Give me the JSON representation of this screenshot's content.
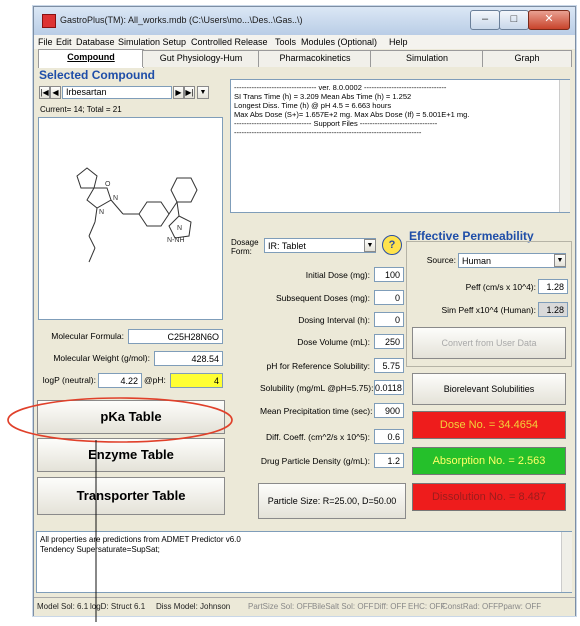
{
  "window": {
    "title": "GastroPlus(TM): All_works.mdb (C:\\Users\\mo...\\Des..\\Gas..\\)"
  },
  "menu": [
    "File",
    "Edit",
    "Database",
    "Simulation Setup",
    "Controlled Release",
    "Tools",
    "Modules (Optional)",
    "Help"
  ],
  "tabs": [
    "Compound",
    "Gut Physiology-Hum",
    "Pharmacokinetics",
    "Simulation",
    "Graph"
  ],
  "compound": {
    "section_title": "Selected Compound",
    "name": "Irbesartan",
    "current_total": "Current= 14; Total = 21",
    "molecular_formula_label": "Molecular Formula:",
    "molecular_formula": "C25H28N6O",
    "mw_label": "Molecular Weight (g/mol):",
    "mw": "428.54",
    "logp_label": "logP (neutral):",
    "logp": "4.22",
    "ph_label": "@pH:",
    "ph": "4"
  },
  "left_buttons": {
    "pka": "pKa Table",
    "enzyme": "Enzyme Table",
    "transporter": "Transporter Table"
  },
  "info_text": [
    "--------------------------------- ver. 8.0.0002 ---------------------------------",
    "SI Trans Time (h) = 3.209          Mean Abs Time (h) = 1.252",
    "Longest Diss. Time (h) @ pH 4.5 = 6.663 hours",
    "Max Abs Dose (S+)= 1.657E+2 mg.      Max Abs Dose (If) = 5.001E+1 mg.",
    "------------------------------- Support Files -------------------------------",
    "---------------------------------------------------------------------------"
  ],
  "dosage": {
    "form_label": "Dosage Form:",
    "form_value": "IR: Tablet",
    "rows": [
      {
        "label": "Initial Dose (mg):",
        "value": "100"
      },
      {
        "label": "Subsequent Doses (mg):",
        "value": "0"
      },
      {
        "label": "Dosing Interval (h):",
        "value": "0"
      },
      {
        "label": "Dose Volume (mL):",
        "value": "250"
      },
      {
        "label": "pH for Reference Solubility:",
        "value": "5.75"
      },
      {
        "label": "Solubility (mg/mL @pH=5.75):",
        "value": "0.0118"
      },
      {
        "label": "Mean Precipitation time (sec):",
        "value": "900"
      },
      {
        "label": "Diff. Coeff. (cm^2/s x 10^5):",
        "value": "0.6"
      },
      {
        "label": "Drug Particle Density (g/mL):",
        "value": "1.2"
      }
    ],
    "particle_size": "Particle Size: R=25.00, D=50.00"
  },
  "permeability": {
    "title": "Effective Permeability",
    "source_label": "Source:",
    "source_value": "Human",
    "peff_label": "Peff (cm/s x 10^4):",
    "peff": "1.28",
    "sim_label": "Sim Peff x10^4 (Human):",
    "sim": "1.28",
    "convert_btn": "Convert from User Data",
    "biorelevant_btn": "Biorelevant Solubilities"
  },
  "results": {
    "dose": "Dose No. = 34.4654",
    "absorption": "Absorption No. = 2.563",
    "dissolution": "Dissolution No. = 8.487"
  },
  "notes": [
    "All properties are predictions from ADMET Predictor v6.0",
    "Tendency Supersaturate=SupSat;"
  ],
  "status": [
    {
      "text": "Model Sol: 6.1",
      "dim": false
    },
    {
      "text": "logD: Struct 6.1",
      "dim": false
    },
    {
      "text": "Diss Model: Johnson",
      "dim": false
    },
    {
      "text": "PartSize Sol: OFF",
      "dim": true
    },
    {
      "text": "BileSalt Sol: OFF",
      "dim": true
    },
    {
      "text": "Diff: OFF",
      "dim": true
    },
    {
      "text": "EHC: OFF",
      "dim": true
    },
    {
      "text": "ConstRad: OFF",
      "dim": true
    },
    {
      "text": "Pparw: OFF",
      "dim": true
    }
  ],
  "colors": {
    "dose_bg": "#ee1c1c",
    "absorption_bg": "#25c02b",
    "dissolution_bg": "#ee1c1c",
    "highlight": "#ffff33",
    "annotation": "#e0402a",
    "title_blue": "#1f4ea8"
  }
}
